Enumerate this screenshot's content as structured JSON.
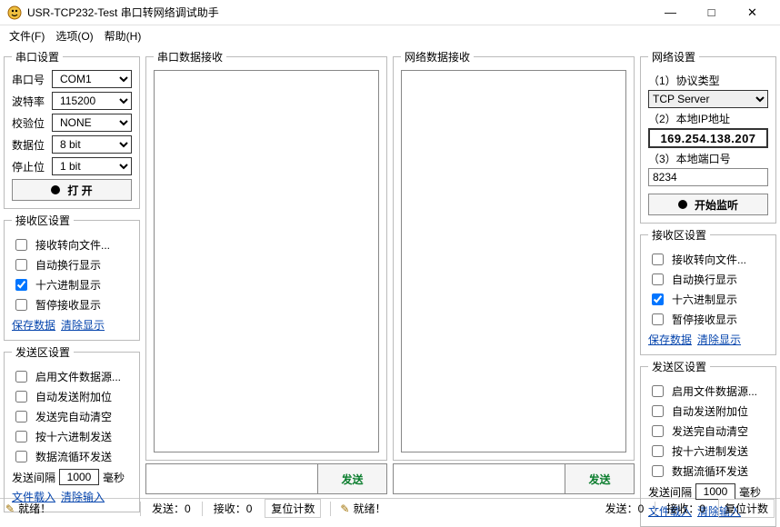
{
  "window": {
    "title": "USR-TCP232-Test 串口转网络调试助手",
    "min": "—",
    "max": "□",
    "close": "✕"
  },
  "menu": {
    "file": "文件(F)",
    "options": "选项(O)",
    "help": "帮助(H)"
  },
  "serial": {
    "group": "串口设置",
    "port_label": "串口号",
    "port_value": "COM1",
    "baud_label": "波特率",
    "baud_value": "115200",
    "parity_label": "校验位",
    "parity_value": "NONE",
    "databits_label": "数据位",
    "databits_value": "8 bit",
    "stopbits_label": "停止位",
    "stopbits_value": "1 bit",
    "open_btn": "打 开"
  },
  "recv_area": {
    "group": "接收区设置",
    "to_file": "接收转向文件...",
    "auto_wrap": "自动换行显示",
    "hex_disp": "十六进制显示",
    "pause": "暂停接收显示",
    "save_link": "保存数据",
    "clear_link": "清除显示"
  },
  "send_area": {
    "group": "发送区设置",
    "file_src": "启用文件数据源...",
    "auto_append": "自动发送附加位",
    "clear_after": "发送完自动清空",
    "hex_send": "按十六进制发送",
    "loop_send": "数据流循环发送",
    "interval_label": "发送间隔",
    "interval_value": "1000",
    "ms_label": "毫秒",
    "load_file": "文件载入",
    "clear_input": "清除输入"
  },
  "center": {
    "serial_recv_label": "串口数据接收",
    "net_recv_label": "网络数据接收",
    "send_btn": "发送"
  },
  "network": {
    "group": "网络设置",
    "proto_label": "（1）协议类型",
    "proto_value": "TCP Server",
    "ip_label": "（2）本地IP地址",
    "ip_value": "169.254.138.207",
    "port_label": "（3）本地端口号",
    "port_value": "8234",
    "listen_btn": "开始监听"
  },
  "status": {
    "ready": "就绪！",
    "send_label": "发送：",
    "send_count": "0",
    "recv_label": "接收：",
    "recv_count": "0",
    "reset_btn": "复位计数"
  }
}
